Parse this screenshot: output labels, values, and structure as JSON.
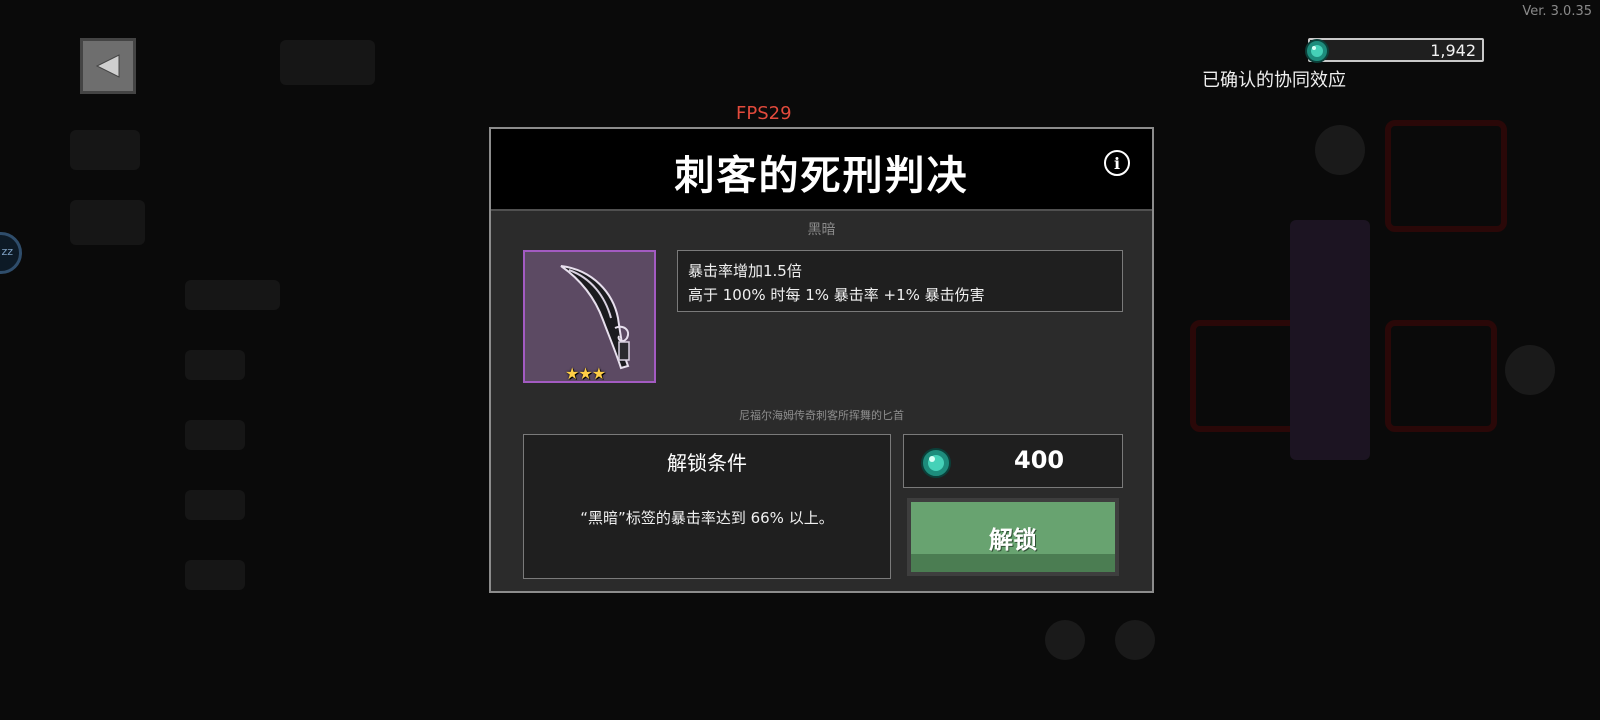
{
  "version": "Ver. 3.0.35",
  "fps": "FPS29",
  "side_badge": "zz",
  "currency": {
    "amount": "1,942",
    "icon": "gem-icon"
  },
  "synergy_label": "已确认的协同效应",
  "modal": {
    "title": "刺客的死刑判决",
    "tag": "黑暗",
    "stars": "★★★",
    "description": [
      "暴击率增加1.5倍",
      "高于 100% 时每 1% 暴击率 +1% 暴击伤害"
    ],
    "flavor": "尼福尔海姆传奇刺客所挥舞的匕首",
    "unlock_condition_title": "解锁条件",
    "unlock_condition_text": "“黑暗”标签的暴击率达到 66% 以上。",
    "price": "400",
    "unlock_button": "解锁"
  },
  "colors": {
    "frame_purple": "#a35bc2",
    "item_bg": "#5c4a63",
    "unlock_green": "#68a370",
    "fps_red": "#e24a3c",
    "star_gold": "#ffce47"
  }
}
